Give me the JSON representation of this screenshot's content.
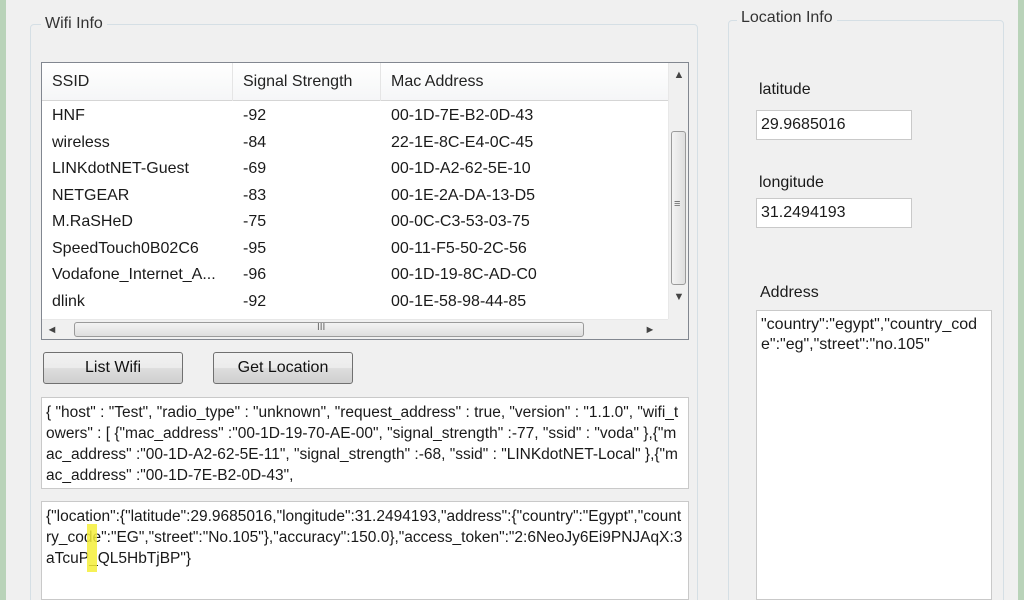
{
  "wifi_group": {
    "title": "Wifi Info",
    "columns": [
      "SSID",
      "Signal Strength",
      "Mac Address"
    ],
    "rows": [
      {
        "ssid": "HNF",
        "signal": "-92",
        "mac": "00-1D-7E-B2-0D-43"
      },
      {
        "ssid": "wireless",
        "signal": "-84",
        "mac": "22-1E-8C-E4-0C-45"
      },
      {
        "ssid": "LINKdotNET-Guest",
        "signal": "-69",
        "mac": "00-1D-A2-62-5E-10"
      },
      {
        "ssid": "NETGEAR",
        "signal": "-83",
        "mac": "00-1E-2A-DA-13-D5"
      },
      {
        "ssid": "M.RaSHeD",
        "signal": "-75",
        "mac": "00-0C-C3-53-03-75"
      },
      {
        "ssid": "SpeedTouch0B02C6",
        "signal": "-95",
        "mac": "00-11-F5-50-2C-56"
      },
      {
        "ssid": "Vodafone_Internet_A...",
        "signal": "-96",
        "mac": "00-1D-19-8C-AD-C0"
      },
      {
        "ssid": "dlink",
        "signal": "-92",
        "mac": "00-1E-58-98-44-85"
      }
    ],
    "scroll_glyphs": {
      "up": "▲",
      "down": "▼",
      "left": "◄",
      "right": "►",
      "vgrip": "≡",
      "hgrip": "III"
    }
  },
  "buttons": {
    "list_wifi": "List Wifi",
    "get_location": "Get Location"
  },
  "request_text": "{ \"host\" : \"Test\", \"radio_type\" : \"unknown\", \"request_address\" : true, \"version\" : \"1.1.0\", \"wifi_towers\" : [ {\"mac_address\" :\"00-1D-19-70-AE-00\", \"signal_strength\" :-77, \"ssid\" : \"voda\" },{\"mac_address\" :\"00-1D-A2-62-5E-11\", \"signal_strength\" :-68, \"ssid\" : \"LINKdotNET-Local\" },{\"mac_address\" :\"00-1D-7E-B2-0D-43\",",
  "response_text": "{\"location\":{\"latitude\":29.9685016,\"longitude\":31.2494193,\"address\":{\"country\":\"Egypt\",\"country_code\":\"EG\",\"street\":\"No.105\"},\"accuracy\":150.0},\"access_token\":\"2:6NeoJy6Ei9PNJAqX:3aTcuP_QL5HbTjBP\"}",
  "location_group": {
    "title": "Location Info",
    "latitude_label": "latitude",
    "latitude_value": "29.9685016",
    "longitude_label": "longitude",
    "longitude_value": "31.2494193",
    "address_label": "Address",
    "address_value": "\"country\":\"egypt\",\"country_code\":\"eg\",\"street\":\"no.105\""
  },
  "colors": {
    "highlight": "#f5ee3a",
    "frame": "#b9d3b9"
  }
}
